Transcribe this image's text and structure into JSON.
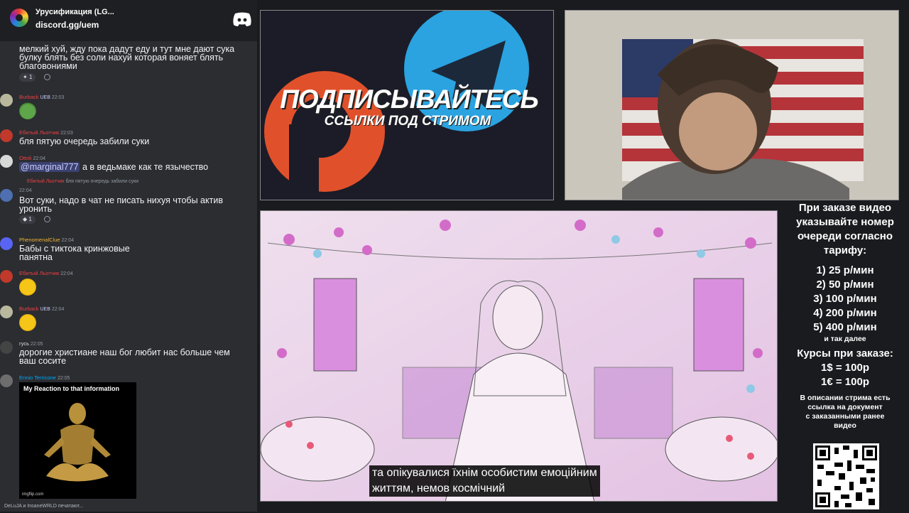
{
  "server": {
    "name": "Урусификация (LG...",
    "invite": "discord.gg/uem"
  },
  "messages": [
    {
      "user": "",
      "text_lines": [
        "мелкий хуй, жду пока дадут еду и тут мне дают сука",
        "булку блять без соли нахуй которая воняет блять",
        "благовониями"
      ],
      "reactions": [
        "1"
      ]
    },
    {
      "user": "Burback",
      "badge": "UEB",
      "time": "22:03",
      "emoji": "pepe"
    },
    {
      "user": "Ебитый Льотчик",
      "time": "22:03",
      "text_lines": [
        "бля пятую очередь забили суки"
      ]
    },
    {
      "user": "Ottoli",
      "time": "22:04",
      "mention": "@marginal777",
      "text_lines": [
        "а в ведьмаке как те язычество"
      ]
    },
    {
      "user": "Ебитый Льотчик",
      "reply": "бля пятую очередь забили суки",
      "time": "22:04",
      "text_lines": [
        "Вот суки, надо в чат не писать нихуя чтобы актив",
        "уронить"
      ],
      "reactions": [
        "1"
      ]
    },
    {
      "user": "PhenomenalClue",
      "time": "22:04",
      "text_lines": [
        "Бабы с тиктока кринжовые",
        "панятна"
      ]
    },
    {
      "user": "Ебитый Льотчик",
      "time": "22:04",
      "emoji": "laugh"
    },
    {
      "user": "Burback",
      "badge": "UEB",
      "time": "22:04",
      "emoji": "laugh"
    },
    {
      "user": "гусь",
      "time": "22:05",
      "text_lines": [
        "дорогие христиане наш бог любит нас больше чем",
        "ваш сосите"
      ]
    },
    {
      "user": "Ennio Terricone",
      "time": "22:05"
    }
  ],
  "meme": {
    "caption": "My Reaction to that information",
    "source": "imgflip.com"
  },
  "typing": "DeLuJA и InsaneWRLD печатают...",
  "promo": {
    "title": "ПОДПИСЫВАЙТЕСЬ",
    "subtitle": "ССЫЛКИ ПОД СТРИМОМ"
  },
  "subtitle": {
    "line1": "та опікувалися їхнім особистим емоційним",
    "line2": "життям, немов космічний"
  },
  "info": {
    "order_lines": [
      "При заказе видео",
      "указывайте номер",
      "очереди согласно",
      "тарифу:"
    ],
    "tariffs": [
      "1) 25 р/мин",
      "2) 50 р/мин",
      "3) 100 р/мин",
      "4) 200 р/мин",
      "5) 400 р/мин"
    ],
    "etc": "и так далее",
    "rates_title": "Курсы при заказе:",
    "rates": [
      "1$ = 100р",
      "1€ = 100р"
    ],
    "desc_lines": [
      "В описании стрима есть",
      "ссылка на документ",
      "с заказанными ранее",
      "видео"
    ]
  },
  "colors": {
    "discord_blurple": "#5865f2",
    "name_red": "#f23f42",
    "name_green": "#3ba55c",
    "name_blue": "#00a8fc",
    "promo_red": "#e0512b",
    "telegram_blue": "#2aa3e0"
  }
}
